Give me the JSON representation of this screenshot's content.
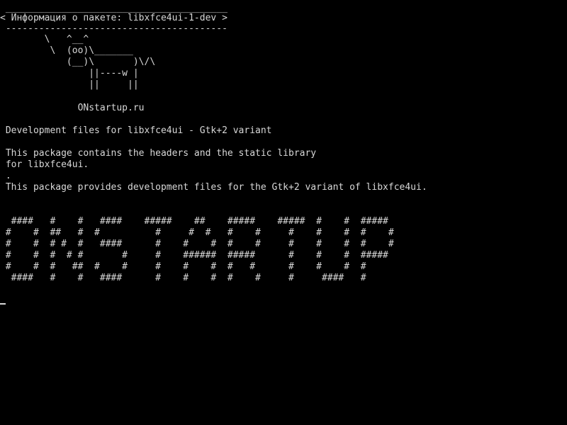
{
  "bubble": {
    "top_border": " ________________________________________",
    "text": "< Информация о пакете: libxfce4ui-1-dev >",
    "bottom_border": " ----------------------------------------"
  },
  "cow": {
    "line1": "        \\   ^__^",
    "line2": "         \\  (oo)\\_______",
    "line3": "            (__)\\       )\\/\\",
    "line4": "                ||----w |",
    "line5": "                ||     ||"
  },
  "site": "              ONstartup.ru",
  "description": {
    "summary": " Development files for libxfce4ui - Gtk+2 variant",
    "para1_line1": " This package contains the headers and the static library",
    "para1_line2": " for libxfce4ui.",
    "separator": " .",
    "para2": " This package provides development files for the Gtk+2 variant of libxfce4ui."
  },
  "banner": {
    "row1": "  ####   #    #   ####    #####    ##    #####    #####  #    #  #####",
    "row2": " #    #  ##   #  #          #     #  #   #    #     #    #    #  #    #",
    "row3": " #    #  # #  #   ####      #    #    #  #    #     #    #    #  #    #",
    "row4": " #    #  #  # #       #     #    ######  #####      #    #    #  #####",
    "row5": " #    #  #   ##  #    #     #    #    #  #   #      #    #    #  #",
    "row6": "  ####   #    #   ####      #    #    #  #    #     #     ####   #"
  },
  "cursor_glyph": "_"
}
